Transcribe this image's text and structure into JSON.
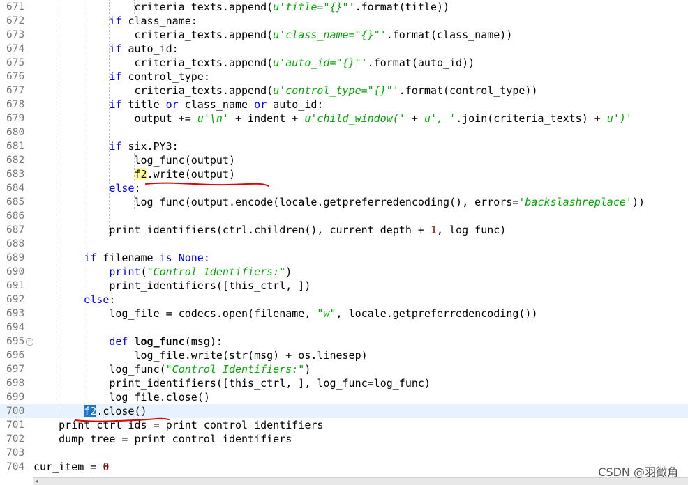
{
  "editor": {
    "lines": [
      {
        "n": "671",
        "current": false,
        "fold": false,
        "tokens": [
          {
            "t": "                criteria_texts.append("
          },
          {
            "t": "u'title=\"{}\"'",
            "c": "str"
          },
          {
            "t": ".format(title))"
          }
        ]
      },
      {
        "n": "672",
        "current": false,
        "fold": false,
        "tokens": [
          {
            "t": "            "
          },
          {
            "t": "if",
            "c": "kw"
          },
          {
            "t": " class_name:"
          }
        ]
      },
      {
        "n": "673",
        "current": false,
        "fold": false,
        "tokens": [
          {
            "t": "                criteria_texts.append("
          },
          {
            "t": "u'class_name=\"{}\"'",
            "c": "str"
          },
          {
            "t": ".format(class_name))"
          }
        ]
      },
      {
        "n": "674",
        "current": false,
        "fold": false,
        "tokens": [
          {
            "t": "            "
          },
          {
            "t": "if",
            "c": "kw"
          },
          {
            "t": " auto_id:"
          }
        ]
      },
      {
        "n": "675",
        "current": false,
        "fold": false,
        "tokens": [
          {
            "t": "                criteria_texts.append("
          },
          {
            "t": "u'auto_id=\"{}\"'",
            "c": "str"
          },
          {
            "t": ".format(auto_id))"
          }
        ]
      },
      {
        "n": "676",
        "current": false,
        "fold": false,
        "tokens": [
          {
            "t": "            "
          },
          {
            "t": "if",
            "c": "kw"
          },
          {
            "t": " control_type:"
          }
        ]
      },
      {
        "n": "677",
        "current": false,
        "fold": false,
        "tokens": [
          {
            "t": "                criteria_texts.append("
          },
          {
            "t": "u'control_type=\"{}\"'",
            "c": "str"
          },
          {
            "t": ".format(control_type))"
          }
        ]
      },
      {
        "n": "678",
        "current": false,
        "fold": false,
        "tokens": [
          {
            "t": "            "
          },
          {
            "t": "if",
            "c": "kw"
          },
          {
            "t": " title "
          },
          {
            "t": "or",
            "c": "kw"
          },
          {
            "t": " class_name "
          },
          {
            "t": "or",
            "c": "kw"
          },
          {
            "t": " auto_id:"
          }
        ]
      },
      {
        "n": "679",
        "current": false,
        "fold": false,
        "tokens": [
          {
            "t": "                output += "
          },
          {
            "t": "u'\\n'",
            "c": "str"
          },
          {
            "t": " + indent + "
          },
          {
            "t": "u'child_window('",
            "c": "str"
          },
          {
            "t": " + "
          },
          {
            "t": "u', '",
            "c": "str"
          },
          {
            "t": ".join(criteria_texts) + "
          },
          {
            "t": "u')'",
            "c": "str"
          }
        ]
      },
      {
        "n": "680",
        "current": false,
        "fold": false,
        "tokens": []
      },
      {
        "n": "681",
        "current": false,
        "fold": false,
        "tokens": [
          {
            "t": "            "
          },
          {
            "t": "if",
            "c": "kw"
          },
          {
            "t": " six.PY3:"
          }
        ]
      },
      {
        "n": "682",
        "current": false,
        "fold": false,
        "tokens": [
          {
            "t": "                log_func(output)"
          }
        ]
      },
      {
        "n": "683",
        "current": false,
        "fold": false,
        "tokens": [
          {
            "t": "                "
          },
          {
            "t": "f2",
            "c": "hl-y"
          },
          {
            "t": ".write(output)"
          }
        ]
      },
      {
        "n": "684",
        "current": false,
        "fold": false,
        "tokens": [
          {
            "t": "            "
          },
          {
            "t": "else",
            "c": "kw"
          },
          {
            "t": ":"
          }
        ]
      },
      {
        "n": "685",
        "current": false,
        "fold": false,
        "tokens": [
          {
            "t": "                log_func(output.encode(locale.getpreferredencoding(), errors="
          },
          {
            "t": "'backslashreplace'",
            "c": "str"
          },
          {
            "t": "))"
          }
        ]
      },
      {
        "n": "686",
        "current": false,
        "fold": false,
        "tokens": []
      },
      {
        "n": "687",
        "current": false,
        "fold": false,
        "tokens": [
          {
            "t": "            print_identifiers(ctrl.children(), current_depth + "
          },
          {
            "t": "1",
            "c": "num"
          },
          {
            "t": ", log_func)"
          }
        ]
      },
      {
        "n": "688",
        "current": false,
        "fold": false,
        "tokens": []
      },
      {
        "n": "689",
        "current": false,
        "fold": false,
        "tokens": [
          {
            "t": "        "
          },
          {
            "t": "if",
            "c": "kw"
          },
          {
            "t": " filename "
          },
          {
            "t": "is",
            "c": "kw"
          },
          {
            "t": " "
          },
          {
            "t": "None",
            "c": "kw"
          },
          {
            "t": ":"
          }
        ]
      },
      {
        "n": "690",
        "current": false,
        "fold": false,
        "tokens": [
          {
            "t": "            "
          },
          {
            "t": "print",
            "c": "kw"
          },
          {
            "t": "("
          },
          {
            "t": "\"Control Identifiers:\"",
            "c": "str"
          },
          {
            "t": ")"
          }
        ]
      },
      {
        "n": "691",
        "current": false,
        "fold": false,
        "tokens": [
          {
            "t": "            print_identifiers([this_ctrl, ])"
          }
        ]
      },
      {
        "n": "692",
        "current": false,
        "fold": false,
        "tokens": [
          {
            "t": "        "
          },
          {
            "t": "else",
            "c": "kw"
          },
          {
            "t": ":"
          }
        ]
      },
      {
        "n": "693",
        "current": false,
        "fold": false,
        "tokens": [
          {
            "t": "            log_file = codecs.open(filename, "
          },
          {
            "t": "\"w\"",
            "c": "str"
          },
          {
            "t": ", locale.getpreferredencoding())"
          }
        ]
      },
      {
        "n": "694",
        "current": false,
        "fold": false,
        "tokens": []
      },
      {
        "n": "695",
        "current": false,
        "fold": true,
        "tokens": [
          {
            "t": "            "
          },
          {
            "t": "def",
            "c": "kw"
          },
          {
            "t": " "
          },
          {
            "t": "log_func",
            "c": "bold"
          },
          {
            "t": "(msg):"
          }
        ]
      },
      {
        "n": "696",
        "current": false,
        "fold": false,
        "tokens": [
          {
            "t": "                log_file.write(str(msg) + os.linesep)"
          }
        ]
      },
      {
        "n": "697",
        "current": false,
        "fold": false,
        "tokens": [
          {
            "t": "            log_func("
          },
          {
            "t": "\"Control Identifiers:\"",
            "c": "str"
          },
          {
            "t": ")"
          }
        ]
      },
      {
        "n": "698",
        "current": false,
        "fold": false,
        "tokens": [
          {
            "t": "            print_identifiers([this_ctrl, ], log_func=log_func)"
          }
        ]
      },
      {
        "n": "699",
        "current": false,
        "fold": false,
        "tokens": [
          {
            "t": "            log_file.close()"
          }
        ]
      },
      {
        "n": "700",
        "current": true,
        "fold": false,
        "tokens": [
          {
            "t": "        "
          },
          {
            "t": "f2",
            "c": "hl-b"
          },
          {
            "t": ".close()"
          }
        ]
      },
      {
        "n": "701",
        "current": false,
        "fold": false,
        "tokens": [
          {
            "t": "    print_ctrl_ids = print_control_identifiers"
          }
        ]
      },
      {
        "n": "702",
        "current": false,
        "fold": false,
        "tokens": [
          {
            "t": "    dump_tree = print_control_identifiers"
          }
        ]
      },
      {
        "n": "703",
        "current": false,
        "fold": false,
        "tokens": []
      },
      {
        "n": "704",
        "current": false,
        "fold": false,
        "tokens": [
          {
            "t": "cur_item = "
          },
          {
            "t": "0",
            "c": "num"
          }
        ]
      }
    ]
  },
  "watermark": "CSDN @羽徵角",
  "colors": {
    "keyword": "#0000ff",
    "string": "#00aa00",
    "number": "#800000",
    "line_number": "#787878",
    "current_line": "#e8f2fe",
    "occurrence_highlight": "#ffff96",
    "selection": "#1e74c8",
    "annotation_red": "#e00000"
  }
}
